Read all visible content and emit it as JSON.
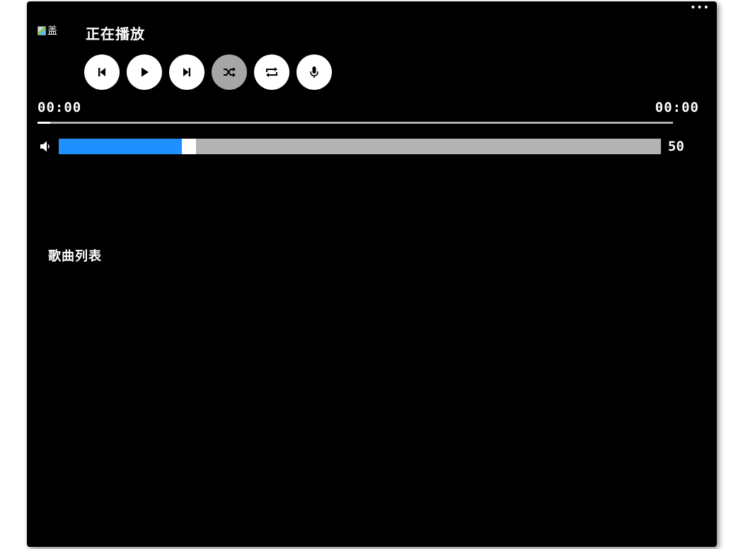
{
  "header": {
    "more_label": "•••",
    "cover_alt": "盖",
    "now_playing_label": "正在播放"
  },
  "controls": [
    {
      "name": "previous-button",
      "icon": "skip-previous-icon",
      "active": false
    },
    {
      "name": "play-button",
      "icon": "play-icon",
      "active": false
    },
    {
      "name": "next-button",
      "icon": "skip-next-icon",
      "active": false
    },
    {
      "name": "shuffle-button",
      "icon": "shuffle-icon",
      "active": true
    },
    {
      "name": "repeat-button",
      "icon": "repeat-icon",
      "active": false
    },
    {
      "name": "microphone-button",
      "icon": "microphone-icon",
      "active": false
    }
  ],
  "progress": {
    "current_time": "00:00",
    "total_time": "00:00",
    "fraction": 0.02
  },
  "volume": {
    "icon": "volume-icon",
    "value": "50",
    "fraction": 0.205
  },
  "playlist": {
    "title": "歌曲列表",
    "items": []
  },
  "colors": {
    "background": "#000000",
    "volume_fill": "#1e90ff",
    "track": "#b3b3b3",
    "active_control": "#a6a6a6"
  }
}
